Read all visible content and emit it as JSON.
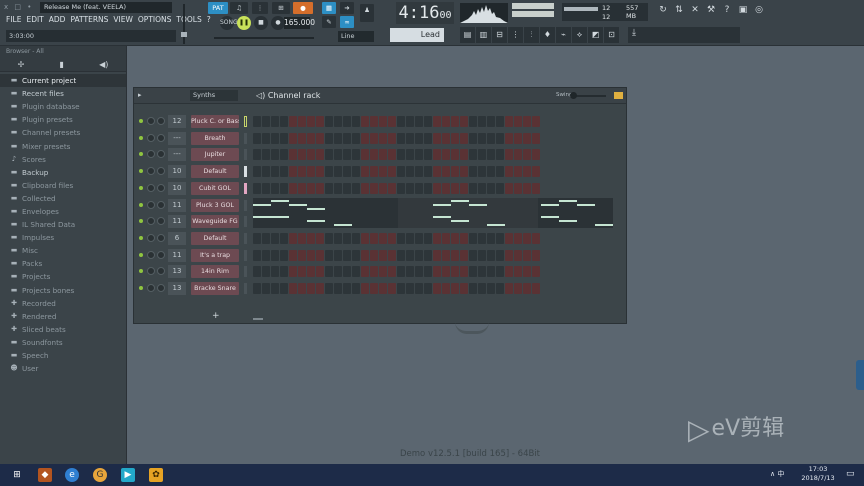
{
  "topbar": {
    "window_controls": "x □ •",
    "song_title": "Release Me (feat. VEELA)",
    "menu": [
      "FILE",
      "EDIT",
      "ADD",
      "PATTERNS",
      "VIEW",
      "OPTIONS",
      "TOOLS",
      "?"
    ],
    "song_time": "3:03:00",
    "pat_label": "PAT",
    "song_label": "SONG",
    "tempo": "165.000",
    "snap_line": "Line",
    "clock_main": "4:16",
    "clock_sub": "00",
    "lead_label": "Lead",
    "cpu_number": "12",
    "memory": "557 MB",
    "voices": "12",
    "icons": [
      "undo-icon",
      "mixer-icon",
      "plugin-icon",
      "wrench-icon",
      "help-icon",
      "save-icon",
      "chat-icon"
    ]
  },
  "browser": {
    "header": "Browser - All",
    "items": [
      {
        "label": "Current project",
        "icon": "folder",
        "state": "active"
      },
      {
        "label": "Recent files",
        "icon": "folder",
        "state": "bright"
      },
      {
        "label": "Plugin database",
        "icon": "folder",
        "state": ""
      },
      {
        "label": "Plugin presets",
        "icon": "folder",
        "state": ""
      },
      {
        "label": "Channel presets",
        "icon": "folder",
        "state": ""
      },
      {
        "label": "Mixer presets",
        "icon": "folder",
        "state": ""
      },
      {
        "label": "Scores",
        "icon": "music",
        "state": ""
      },
      {
        "label": "Backup",
        "icon": "folder",
        "state": "bright"
      },
      {
        "label": "Clipboard files",
        "icon": "folder",
        "state": ""
      },
      {
        "label": "Collected",
        "icon": "folder",
        "state": ""
      },
      {
        "label": "Envelopes",
        "icon": "folder",
        "state": ""
      },
      {
        "label": "IL Shared Data",
        "icon": "folder",
        "state": ""
      },
      {
        "label": "Impulses",
        "icon": "folder",
        "state": ""
      },
      {
        "label": "Misc",
        "icon": "folder",
        "state": ""
      },
      {
        "label": "Packs",
        "icon": "folder",
        "state": ""
      },
      {
        "label": "Projects",
        "icon": "folder",
        "state": ""
      },
      {
        "label": "Projects bones",
        "icon": "folder",
        "state": ""
      },
      {
        "label": "Recorded",
        "icon": "plus",
        "state": ""
      },
      {
        "label": "Rendered",
        "icon": "plus",
        "state": ""
      },
      {
        "label": "Sliced beats",
        "icon": "plus",
        "state": ""
      },
      {
        "label": "Soundfonts",
        "icon": "folder",
        "state": ""
      },
      {
        "label": "Speech",
        "icon": "folder",
        "state": ""
      },
      {
        "label": "User",
        "icon": "user",
        "state": ""
      }
    ]
  },
  "rack": {
    "filter": "Synths",
    "title": "Channel rack",
    "swing_label": "Swing",
    "add_label": "+",
    "channels": [
      {
        "mixer": "12",
        "name": "Pluck C. or Bass",
        "steps": [
          1,
          1,
          1,
          0,
          1,
          1,
          1,
          0,
          1,
          1,
          1,
          0,
          1,
          1,
          1,
          0,
          1,
          1,
          1,
          0,
          1,
          1,
          1,
          0,
          1,
          1,
          1,
          0,
          1,
          1,
          1,
          0
        ]
      },
      {
        "mixer": "---",
        "name": "Breath",
        "steps": [
          1,
          1,
          1,
          0,
          1,
          1,
          1,
          0,
          1,
          1,
          1,
          0,
          1,
          1,
          1,
          0,
          1,
          1,
          1,
          0,
          1,
          1,
          1,
          0,
          1,
          1,
          1,
          0,
          1,
          1,
          1,
          0
        ]
      },
      {
        "mixer": "---",
        "name": "Jupiter",
        "steps": [
          1,
          1,
          1,
          0,
          1,
          1,
          1,
          0,
          1,
          1,
          1,
          0,
          1,
          1,
          1,
          0,
          1,
          1,
          1,
          0,
          1,
          1,
          1,
          0,
          1,
          1,
          1,
          0,
          1,
          1,
          1,
          0
        ]
      },
      {
        "mixer": "10",
        "name": "Default",
        "steps": [
          1,
          1,
          1,
          0,
          1,
          1,
          1,
          0,
          1,
          1,
          1,
          0,
          1,
          1,
          1,
          0,
          1,
          1,
          1,
          0,
          1,
          1,
          1,
          0,
          1,
          1,
          1,
          0,
          1,
          1,
          1,
          0
        ]
      },
      {
        "mixer": "10",
        "name": "Cubit GOL",
        "steps": [
          1,
          1,
          1,
          0,
          1,
          1,
          1,
          0,
          1,
          1,
          1,
          0,
          1,
          1,
          1,
          0,
          1,
          1,
          1,
          0,
          1,
          1,
          1,
          0,
          1,
          1,
          1,
          0,
          1,
          1,
          1,
          0
        ]
      },
      {
        "mixer": "11",
        "name": "Pluck 3 GOL",
        "steps": null
      },
      {
        "mixer": "11",
        "name": "Waveguide FG",
        "steps": null
      },
      {
        "mixer": "6",
        "name": "Default",
        "steps": [
          1,
          1,
          1,
          0,
          1,
          1,
          1,
          0,
          1,
          1,
          1,
          0,
          1,
          1,
          1,
          0,
          1,
          1,
          1,
          0,
          1,
          1,
          1,
          0,
          1,
          1,
          1,
          0,
          1,
          1,
          1,
          0
        ]
      },
      {
        "mixer": "11",
        "name": "It's a trap",
        "steps": [
          1,
          1,
          1,
          0,
          1,
          1,
          1,
          0,
          1,
          1,
          1,
          0,
          1,
          1,
          1,
          0,
          1,
          1,
          1,
          0,
          1,
          1,
          1,
          0,
          1,
          1,
          1,
          0,
          1,
          1,
          1,
          0
        ]
      },
      {
        "mixer": "13",
        "name": "14in Rim",
        "steps": [
          1,
          1,
          1,
          0,
          1,
          1,
          1,
          0,
          1,
          1,
          1,
          0,
          1,
          1,
          1,
          0,
          1,
          1,
          1,
          0,
          1,
          1,
          1,
          0,
          1,
          1,
          1,
          0,
          1,
          1,
          1,
          0
        ]
      },
      {
        "mixer": "13",
        "name": "Bracke Snare",
        "steps": [
          1,
          1,
          1,
          0,
          1,
          1,
          1,
          0,
          1,
          1,
          1,
          0,
          1,
          1,
          1,
          0,
          1,
          1,
          1,
          0,
          1,
          1,
          1,
          0,
          1,
          1,
          1,
          0,
          1,
          1,
          1,
          0
        ]
      }
    ],
    "roll_notes": [
      {
        "start": 0,
        "len": 2,
        "lane": 1
      },
      {
        "start": 2,
        "len": 2,
        "lane": 0
      },
      {
        "start": 4,
        "len": 2,
        "lane": 1
      },
      {
        "start": 6,
        "len": 2,
        "lane": 2
      },
      {
        "start": 0,
        "len": 2,
        "lane": 4
      },
      {
        "start": 2,
        "len": 2,
        "lane": 4
      },
      {
        "start": 6,
        "len": 2,
        "lane": 5
      },
      {
        "start": 9,
        "len": 2,
        "lane": 6
      },
      {
        "start": 20,
        "len": 2,
        "lane": 1
      },
      {
        "start": 22,
        "len": 2,
        "lane": 0
      },
      {
        "start": 24,
        "len": 2,
        "lane": 1
      },
      {
        "start": 20,
        "len": 2,
        "lane": 4
      },
      {
        "start": 22,
        "len": 2,
        "lane": 5
      },
      {
        "start": 26,
        "len": 2,
        "lane": 6
      },
      {
        "start": 32,
        "len": 2,
        "lane": 1
      },
      {
        "start": 34,
        "len": 2,
        "lane": 0
      },
      {
        "start": 36,
        "len": 2,
        "lane": 1
      },
      {
        "start": 32,
        "len": 2,
        "lane": 4
      },
      {
        "start": 34,
        "len": 2,
        "lane": 5
      },
      {
        "start": 38,
        "len": 2,
        "lane": 6
      }
    ]
  },
  "status": {
    "version": "Demo v12.5.1 [build 165] - 64Bit"
  },
  "watermark": {
    "text": "eV剪辑"
  },
  "taskbar": {
    "tray_chars": "∧ 中",
    "time": "17:03",
    "date": "2018/7/13"
  },
  "colors": {
    "accent_blue": "#2d8fc4",
    "accent_orange": "#d56e2b",
    "step_red": "#5a3234",
    "channel_name_bg": "#6d4a52"
  }
}
